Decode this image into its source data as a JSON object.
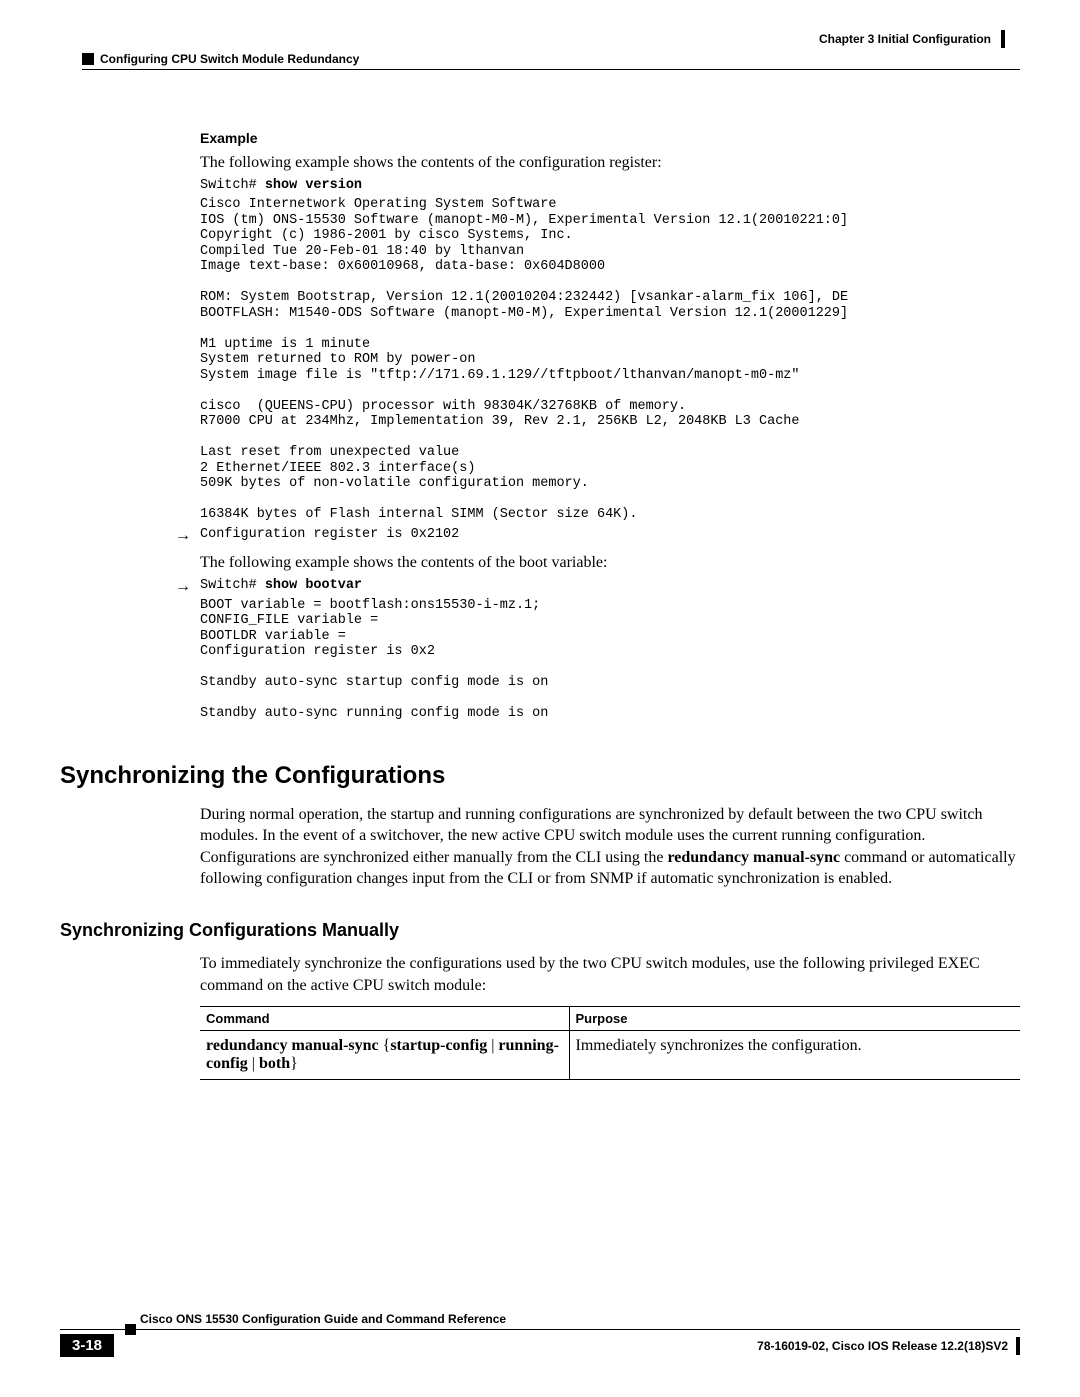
{
  "header": {
    "chapter": "Chapter 3    Initial Configuration",
    "section": "Configuring CPU Switch Module Redundancy"
  },
  "example": {
    "heading": "Example",
    "intro1": "The following example shows the contents of the configuration register:",
    "prompt1": "Switch# ",
    "cmd1": "show version",
    "out1": "Cisco Internetwork Operating System Software\nIOS (tm) ONS-15530 Software (manopt-M0-M), Experimental Version 12.1(20010221:0]\nCopyright (c) 1986-2001 by cisco Systems, Inc.\nCompiled Tue 20-Feb-01 18:40 by lthanvan\nImage text-base: 0x60010968, data-base: 0x604D8000\n\nROM: System Bootstrap, Version 12.1(20010204:232442) [vsankar-alarm_fix 106], DE\nBOOTFLASH: M1540-ODS Software (manopt-M0-M), Experimental Version 12.1(20001229]\n\nM1 uptime is 1 minute\nSystem returned to ROM by power-on\nSystem image file is \"tftp://171.69.1.129//tftpboot/lthanvan/manopt-m0-mz\"\n\ncisco  (QUEENS-CPU) processor with 98304K/32768KB of memory.\nR7000 CPU at 234Mhz, Implementation 39, Rev 2.1, 256KB L2, 2048KB L3 Cache\n\nLast reset from unexpected value\n2 Ethernet/IEEE 802.3 interface(s)\n509K bytes of non-volatile configuration memory.\n\n16384K bytes of Flash internal SIMM (Sector size 64K).",
    "out1_arrow": "Configuration register is 0x2102",
    "intro2": "The following example shows the contents of the boot variable:",
    "prompt2": "Switch# ",
    "cmd2": "show bootvar",
    "out2": "BOOT variable = bootflash:ons15530-i-mz.1;\nCONFIG_FILE variable =\nBOOTLDR variable =\nConfiguration register is 0x2\n\nStandby auto-sync startup config mode is on\n\nStandby auto-sync running config mode is on"
  },
  "sync": {
    "h2": "Synchronizing the Configurations",
    "p1": "During normal operation, the startup and running configurations are synchronized by default between the two CPU switch modules. In the event of a switchover, the new active CPU switch module uses the current running configuration. Configurations are synchronized either manually from the CLI using the ",
    "p1b": "redundancy manual-sync",
    "p1c": " command or automatically following configuration changes input from the CLI or from SNMP if automatic synchronization is enabled.",
    "h3": "Synchronizing Configurations Manually",
    "p2": "To immediately synchronize the configurations used by the two CPU switch modules, use the following privileged EXEC command on the active CPU switch module:",
    "table": {
      "h1": "Command",
      "h2": "Purpose",
      "c1a": "redundancy manual-sync",
      "c1b": " {",
      "c1c": "startup-config",
      "c1d": " | ",
      "c1e": "running-config",
      "c1f": " | ",
      "c1g": "both",
      "c1h": "}",
      "c2": "Immediately synchronizes the configuration."
    }
  },
  "footer": {
    "title": "Cisco ONS 15530 Configuration Guide and Command Reference",
    "page": "3-18",
    "right": "78-16019-02, Cisco IOS Release 12.2(18)SV2"
  }
}
